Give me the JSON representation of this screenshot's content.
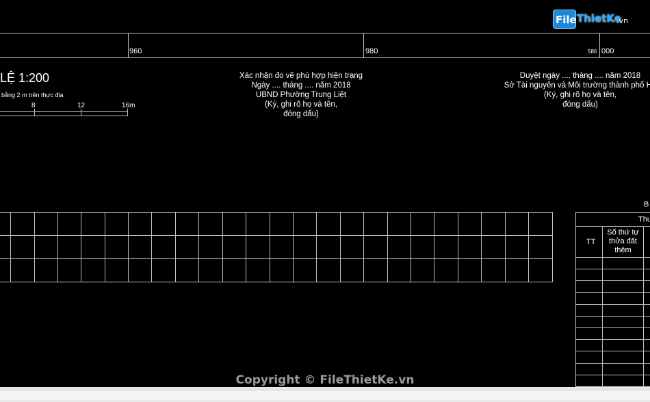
{
  "logo": {
    "box_text": "File",
    "rest_text": "ThietKe",
    "suffix": ".vn"
  },
  "ruler": {
    "labels": [
      "960",
      "980",
      "586",
      "000"
    ]
  },
  "scale": {
    "title": "LỆ 1:200",
    "note": "bằng 2 m trên thực địa",
    "ticks": [
      "8",
      "12",
      "16m"
    ]
  },
  "confirm_block": {
    "lines": [
      "Xác nhận đo vẽ phù hợp hiện trạng",
      "Ngày .... tháng .... năm 2018",
      "UBND Phường Trung Liệt",
      "(Ký, ghi rõ họ và tên,",
      "đóng dấu)"
    ]
  },
  "approve_block": {
    "lines": [
      "Duyệt ngày .... tháng .... năm 2018",
      "Sở Tài nguyên và Môi trường thành phố Hà",
      "(Ký, ghi rõ họ và tên,",
      "đóng dấu)"
    ]
  },
  "right_table": {
    "title_fragment": "B",
    "header_fragment": "Thu",
    "col_tt": "TT",
    "col_plot_lines": [
      "Số thứ tự",
      "thửa đất",
      "thêm"
    ]
  },
  "footer": {
    "copyright": "Copyright © FileThietKe.vn"
  }
}
